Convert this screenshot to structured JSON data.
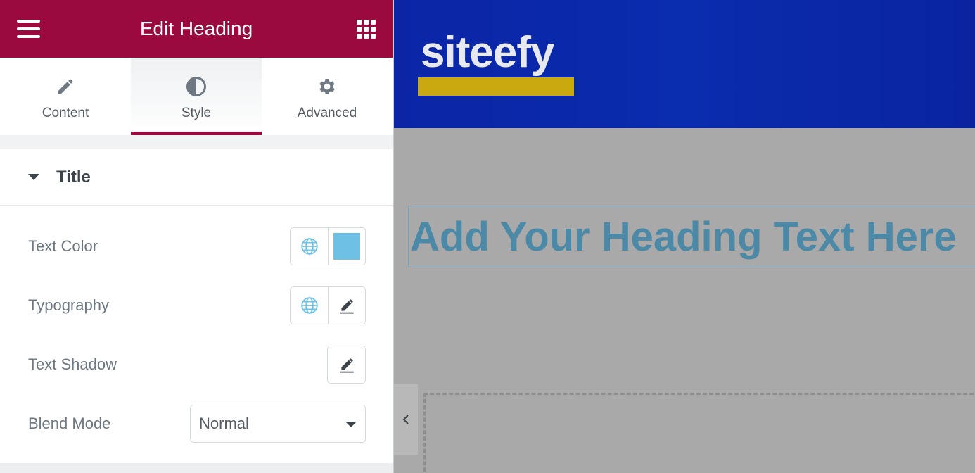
{
  "panel": {
    "title": "Edit Heading",
    "icons": {
      "menu": "hamburger-icon",
      "apps": "apps-grid-icon"
    }
  },
  "tabs": [
    {
      "label": "Content",
      "icon": "pencil-icon",
      "active": false
    },
    {
      "label": "Style",
      "icon": "half-circle-icon",
      "active": true
    },
    {
      "label": "Advanced",
      "icon": "gear-icon",
      "active": false
    }
  ],
  "section": {
    "title": "Title"
  },
  "controls": {
    "text_color": {
      "label": "Text Color",
      "swatch": "#6ec1e4"
    },
    "typography": {
      "label": "Typography"
    },
    "text_shadow": {
      "label": "Text Shadow"
    },
    "blend_mode": {
      "label": "Blend Mode",
      "value": "Normal"
    }
  },
  "canvas": {
    "logo_text": "siteefy",
    "heading": "Add Your Heading Text Here"
  },
  "colors": {
    "brand": "#9b0a3f",
    "header_blue": "#0a2cae",
    "logo_bar": "#c9a90f",
    "heading": "#4b89a7",
    "global_icon": "#6ec1e4"
  }
}
